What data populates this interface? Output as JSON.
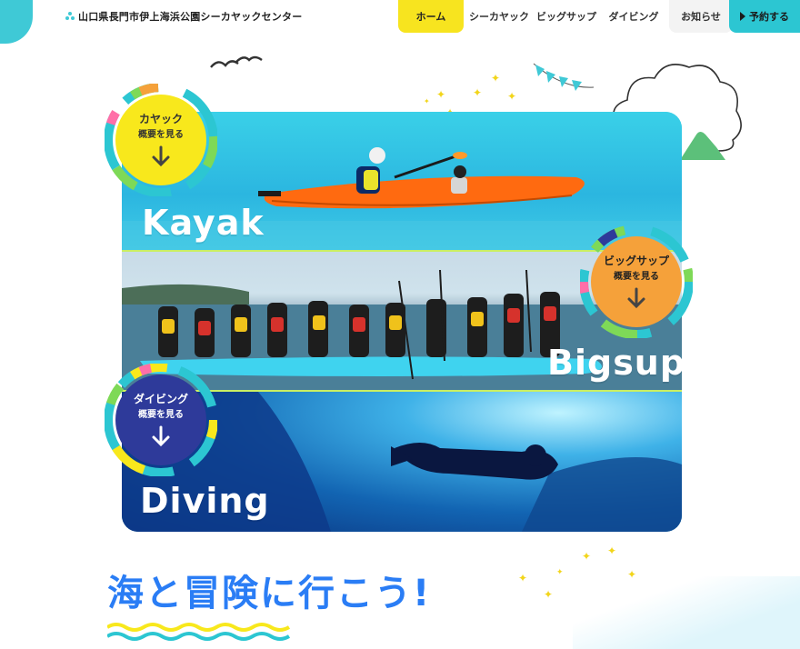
{
  "site": {
    "title": "山口県長門市伊上海浜公園シーカヤックセンター"
  },
  "nav": {
    "items": [
      {
        "label": "ホーム",
        "active": true
      },
      {
        "label": "シーカヤック"
      },
      {
        "label": "ビッグサップ"
      },
      {
        "label": "ダイビング"
      },
      {
        "label": "お知らせ"
      }
    ],
    "reserve_label": "予約する"
  },
  "panels": [
    {
      "title": "Kayak",
      "badge_title": "カヤック",
      "badge_sub": "概要を見る",
      "badge_color": "#f8e81c"
    },
    {
      "title": "Bigsup",
      "badge_title": "ビッグサップ",
      "badge_sub": "概要を見る",
      "badge_color": "#f5a13a"
    },
    {
      "title": "Diving",
      "badge_title": "ダイビング",
      "badge_sub": "概要を見る",
      "badge_color": "#2e3a9a"
    }
  ],
  "headline": "海と冒険に行こう!",
  "colors": {
    "accent": "#2cc6d2",
    "active_nav": "#f7e41f",
    "headline": "#2a7df5",
    "divider": "#c9ef63"
  },
  "icons": [
    "arrow-down-icon",
    "play-triangle-icon",
    "cloud-icon",
    "bird-icon",
    "sparkle-icon",
    "bunting-icon",
    "mountain-icon",
    "wave-icon"
  ]
}
